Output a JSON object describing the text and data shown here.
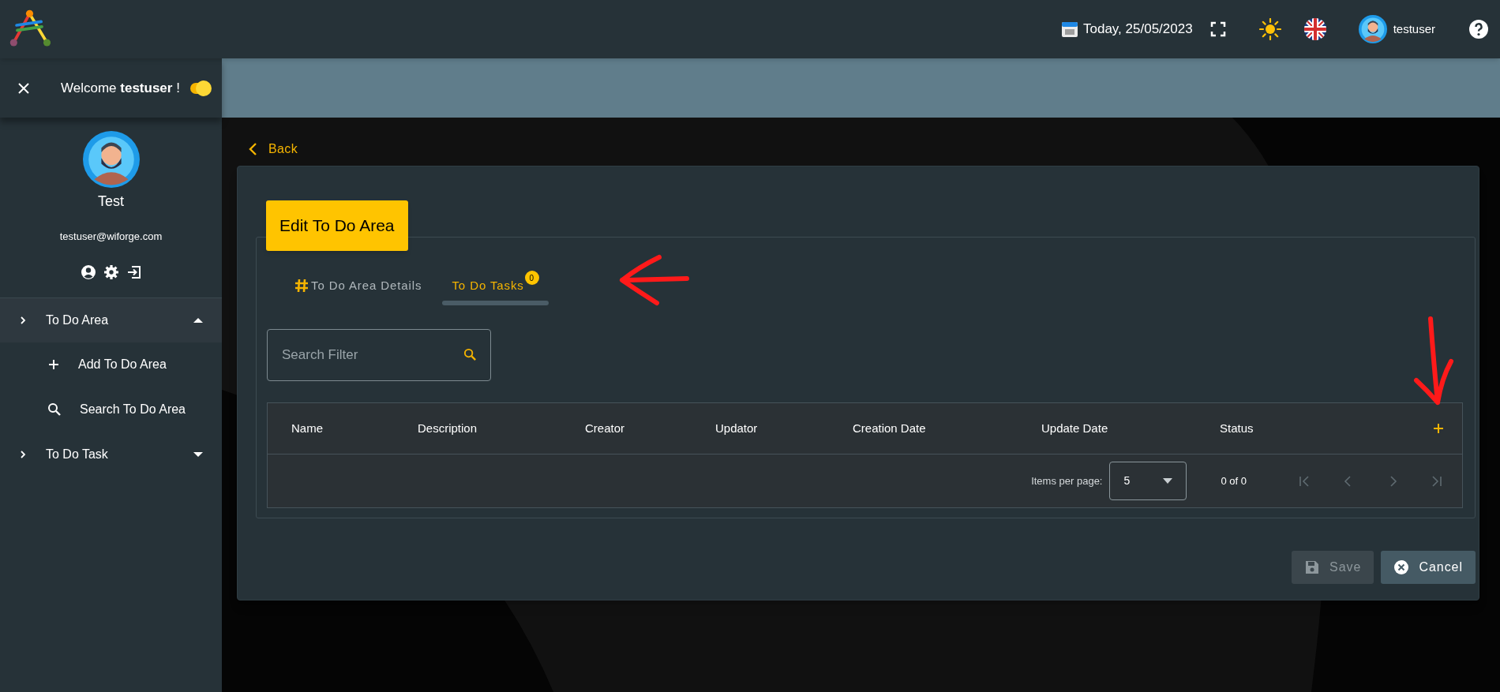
{
  "header": {
    "date": "Today, 25/05/2023",
    "username": "testuser"
  },
  "sidebar": {
    "welcome": "Welcome **testuser** !",
    "theme_toggle": {
      "on": true
    },
    "profile": {
      "name": "Test",
      "email": "testuser@wiforge.com"
    },
    "nav": [
      {
        "label": "To Do Area",
        "expanded": true,
        "children": [
          {
            "label": "Add To Do Area",
            "kind": "add"
          },
          {
            "label": "Search To Do Area",
            "kind": "search"
          }
        ]
      },
      {
        "label": "To Do Task",
        "expanded": false
      }
    ]
  },
  "back": "Back",
  "form": {
    "title": "Edit To Do Area",
    "tabs": [
      {
        "label": "To Do Area Details",
        "kind": "details",
        "selected": false
      },
      {
        "label": "To Do Tasks",
        "kind": "tasks",
        "selected": true,
        "badge": "0"
      }
    ],
    "search": {
      "placeholder": "Search Filter"
    },
    "table": {
      "columns": [
        "Name",
        "Description",
        "Creator",
        "Updator",
        "Creation Date",
        "Update Date",
        "Status"
      ]
    },
    "paginator": {
      "label": "Items per page:",
      "page_size": "5",
      "range": "0 of 0"
    },
    "buttons": [
      {
        "label": "Save",
        "kind": "save",
        "disabled": true
      },
      {
        "label": "Cancel",
        "kind": "cancel",
        "disabled": false
      }
    ]
  }
}
